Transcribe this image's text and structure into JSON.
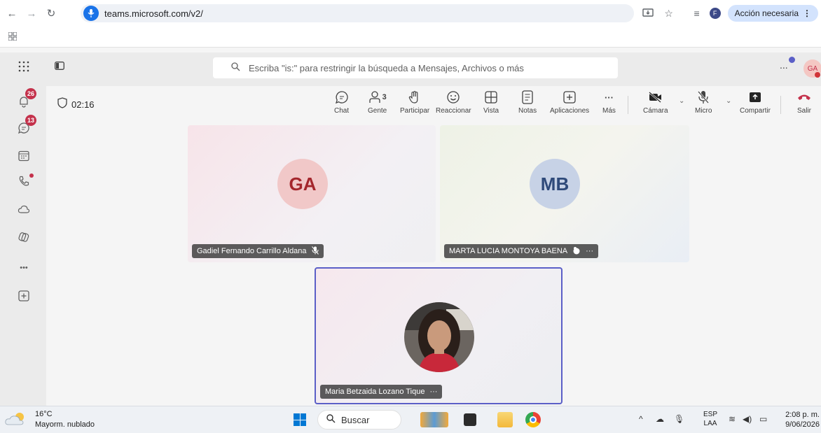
{
  "browser": {
    "url": "teams.microsoft.com/v2/",
    "profile_initial": "F",
    "action_label": "Acción necesaria",
    "icons": [
      "back-icon",
      "forward-icon",
      "reload-icon",
      "site-settings-icon",
      "install-app-icon",
      "star-icon",
      "reading-list-icon",
      "more-vert-icon",
      "apps-grid-icon"
    ]
  },
  "teams_header": {
    "search_placeholder": "Escriba \"is:\" para restringir la búsqueda a Mensajes, Archivos o más",
    "avatar_initials": "GA",
    "more_label": "..."
  },
  "app_bar": {
    "activity_badge": "26",
    "chat_badge": "13",
    "more_label": "•••"
  },
  "meeting_toolbar": {
    "timer": "02:16",
    "people_count": "3",
    "buttons": {
      "chat": "Chat",
      "people": "Gente",
      "raise": "Participar",
      "react": "Reaccionar",
      "view": "Vista",
      "notes": "Notas",
      "apps": "Aplicaciones",
      "more": "Más",
      "camera": "Cámara",
      "mic": "Micro",
      "share": "Compartir",
      "leave": "Salir"
    }
  },
  "participants": [
    {
      "initials": "GA",
      "name": "Gadiel Fernando Carrillo Aldana",
      "muted": true
    },
    {
      "initials": "MB",
      "name": "MARTA LUCIA MONTOYA BAENA",
      "extra": "···"
    },
    {
      "name": "Maria Betzaida Lozano Tique",
      "extra": "···",
      "has_photo": true,
      "speaking": true
    }
  ],
  "taskbar": {
    "temperature": "16°C",
    "weather": "Mayorm. nublado",
    "search_label": "Buscar",
    "lang_top": "ESP",
    "lang_bottom": "LAA",
    "time": "2:08 p. m.",
    "date": "9/06/2026"
  },
  "colors": {
    "teams_accent": "#5b5fc7",
    "badge_red": "#c4314b",
    "leave_red": "#c4314b"
  }
}
